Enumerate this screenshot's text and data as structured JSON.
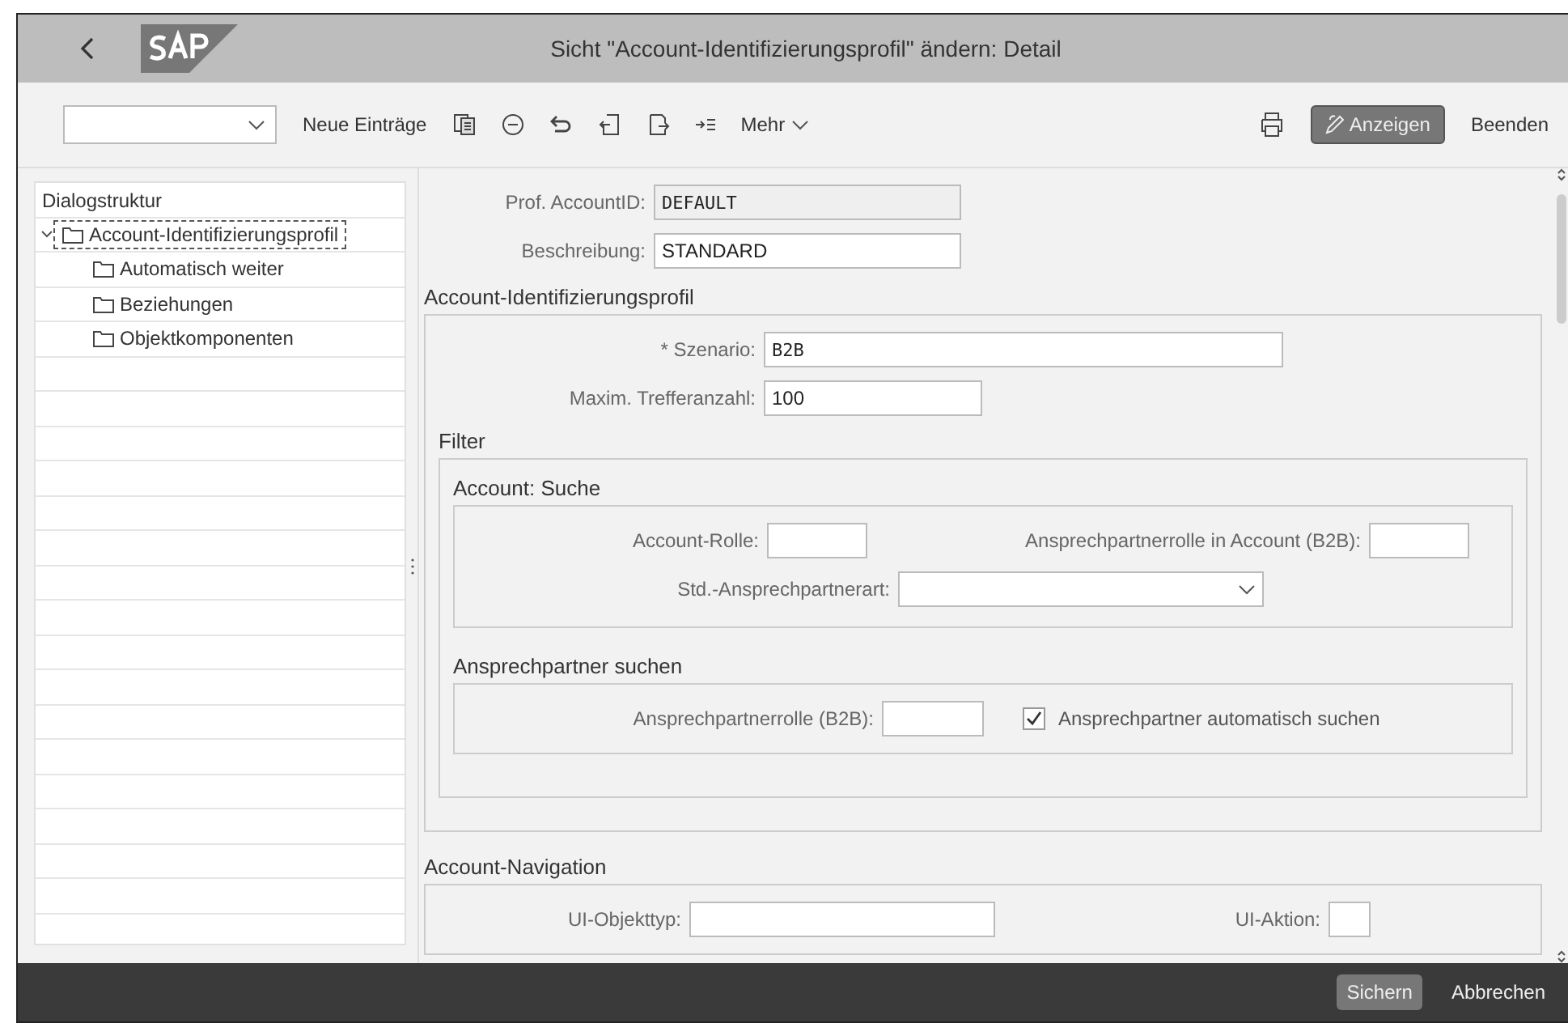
{
  "window": {
    "title": "Sicht \"Account-Identifizierungsprofil\" ändern: Detail"
  },
  "toolbar": {
    "new_entries": "Neue Einträge",
    "more": "Mehr",
    "display_button": "Anzeigen",
    "exit": "Beenden"
  },
  "sidebar": {
    "title": "Dialogstruktur",
    "tree": [
      {
        "label": "Account-Identifizierungsprofil",
        "expanded": true,
        "selected": true,
        "children": [
          {
            "label": "Automatisch weiter",
            "selected": false
          },
          {
            "label": "Beziehungen",
            "selected": false
          },
          {
            "label": "Objektkomponenten",
            "selected": false
          }
        ]
      }
    ]
  },
  "header_fields": [
    {
      "label": "Prof. AccountID:",
      "value": "DEFAULT",
      "readonly": true
    },
    {
      "label": "Beschreibung:",
      "value": "STANDARD",
      "readonly": false
    }
  ],
  "profile_section": {
    "title": "Account-Identifizierungsprofil",
    "fields": [
      {
        "label": "* Szenario:",
        "value": "B2B"
      },
      {
        "label": "Maxim. Trefferanzahl:",
        "value": "100"
      }
    ],
    "filter": {
      "title": "Filter",
      "account_search": {
        "title": "Account: Suche",
        "account_role": "Account-Rolle:",
        "contact_role_in_account": "Ansprechpartnerrolle in Account (B2B):",
        "contact_type": "Std.-Ansprechpartnerart:"
      },
      "contact_search": {
        "title": "Ansprechpartner suchen",
        "contact_role": "Ansprechpartnerrolle (B2B):",
        "auto_search": {
          "label": "Ansprechpartner automatisch suchen",
          "checked": true
        }
      }
    }
  },
  "navigation_section": {
    "title": "Account-Navigation",
    "object_type": "UI-Objekttyp:",
    "action": "UI-Aktion:"
  },
  "footer": {
    "save": "Sichern",
    "cancel": "Abbrechen"
  }
}
